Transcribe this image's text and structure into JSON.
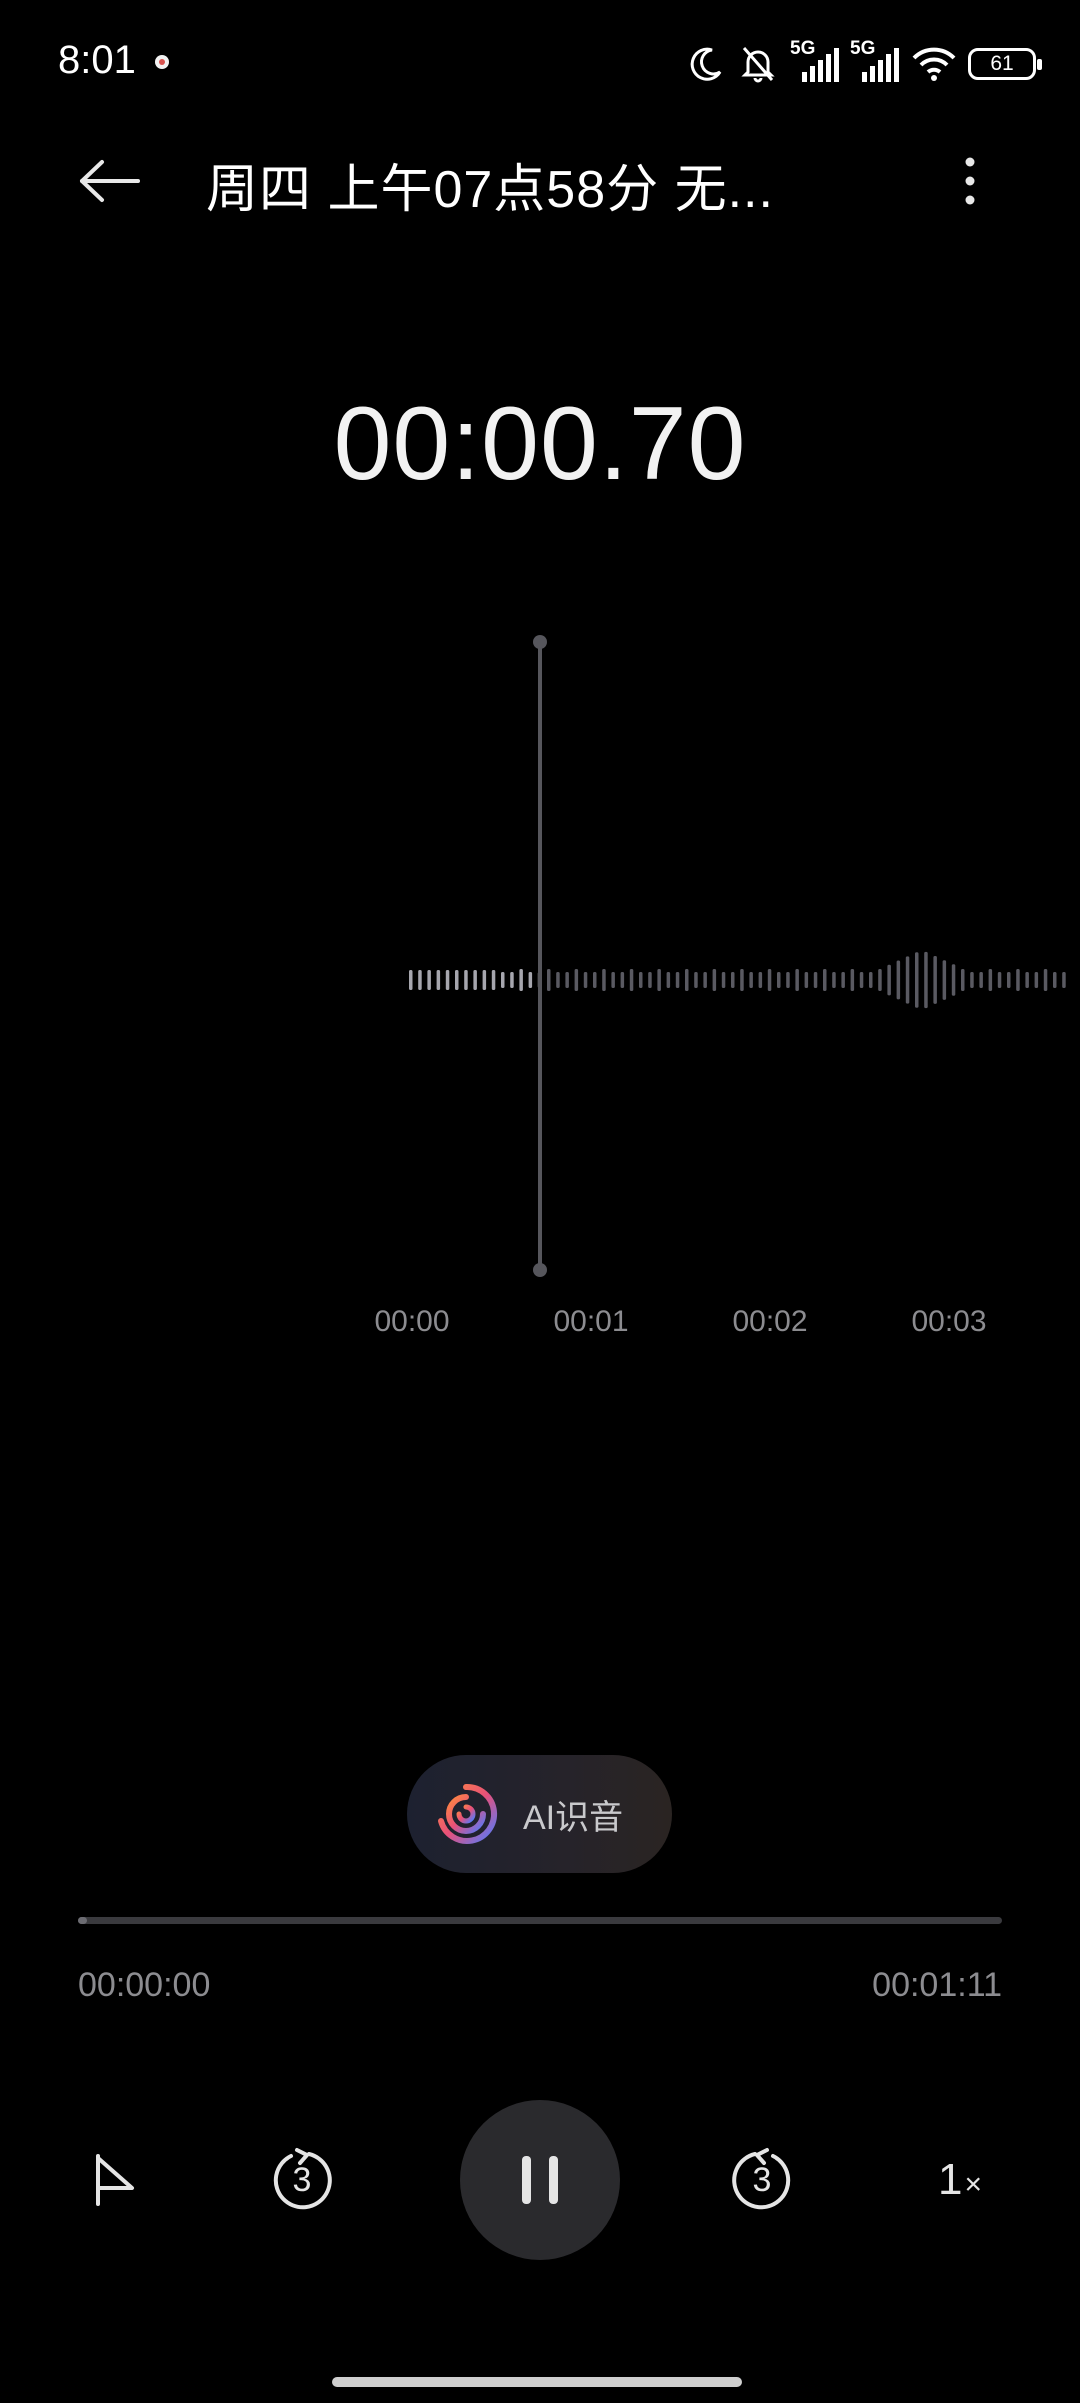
{
  "status_bar": {
    "time": "8:01",
    "network_1": "5G",
    "network_2": "5G",
    "battery": "61"
  },
  "header": {
    "title": "周四 上午07点58分 无..."
  },
  "timer": "00:00.70",
  "waveform": {
    "time_labels": [
      "00:00",
      "00:01",
      "00:02",
      "00:03"
    ]
  },
  "ai_button": {
    "label": "AI识音"
  },
  "playback": {
    "current_time": "00:00:00",
    "total_time": "00:01:11",
    "progress": 0.01,
    "rewind_seconds": "3",
    "forward_seconds": "3",
    "speed": "1",
    "speed_suffix": "×"
  },
  "colors": {
    "background": "#000000",
    "accent_waveform": "#8a8a92"
  }
}
